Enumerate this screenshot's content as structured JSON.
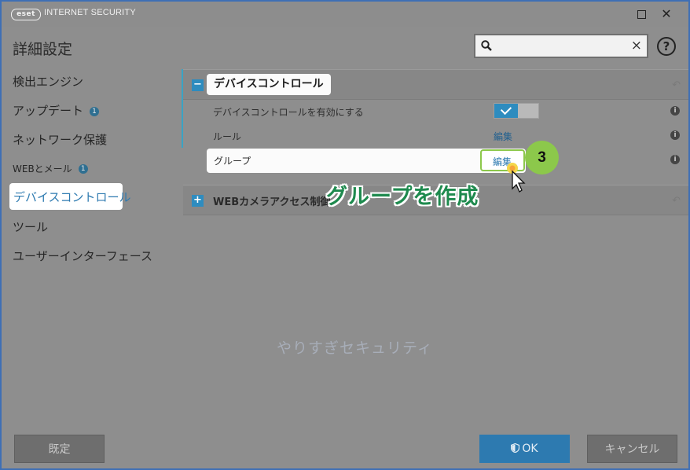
{
  "titlebar": {
    "logo_text": "eset",
    "app_title": "INTERNET SECURITY",
    "close_glyph": "✕"
  },
  "header": {
    "page_title": "詳細設定",
    "search_value": "",
    "search_clear": "×",
    "help_glyph": "?"
  },
  "sidebar": {
    "items": [
      {
        "label": "検出エンジン"
      },
      {
        "label": "アップデート",
        "badge": "1"
      },
      {
        "label": "ネットワーク保護"
      },
      {
        "label": "WEBとメール",
        "badge": "1"
      },
      {
        "label": "デバイスコントロール",
        "active": true
      },
      {
        "label": "ツール"
      },
      {
        "label": "ユーザーインターフェース"
      }
    ]
  },
  "device_control": {
    "header": "デバイスコントロール",
    "collapse_glyph": "−",
    "enable_label": "デバイスコントロールを有効にする",
    "enable_on": true,
    "rules_label": "ルール",
    "rules_edit": "編集",
    "groups_label": "グループ",
    "groups_edit": "編集",
    "info_glyph": "i",
    "reset_glyph": "↶"
  },
  "webcam": {
    "header": "WEBカメラアクセス制御",
    "expand_glyph": "+"
  },
  "annotation": {
    "step_number": "3",
    "callout": "グループを作成",
    "watermark": "やりすぎセキュリティ"
  },
  "footer": {
    "default_label": "既定",
    "ok_label": "OK",
    "cancel_label": "キャンセル"
  },
  "colors": {
    "accent": "#2d7ab0",
    "highlight_green": "#8cc84b",
    "callout_text": "#1e8a4e",
    "window_border": "#3f6fb5"
  }
}
